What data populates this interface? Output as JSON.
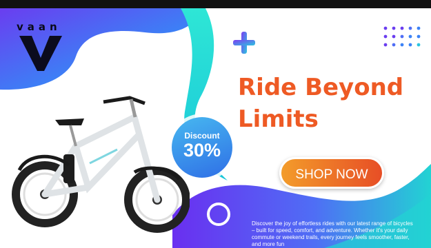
{
  "brand": {
    "name": "vaan"
  },
  "hero": {
    "headline_line1": "Ride Beyond",
    "headline_line2": "Limits"
  },
  "discount": {
    "label": "Discount",
    "value": "30%"
  },
  "cta": {
    "label": "SHOP NOW"
  },
  "description": "Discover the joy of effortless rides with our latest range of bicycles – built for speed, comfort, and adventure. Whether it's your daily commute or weekend trails, every journey feels smoother, faster, and more fun",
  "colors": {
    "accent_orange": "#ee5a24",
    "gradient_purple": "#6a3df0",
    "gradient_cyan": "#22d3d3",
    "gradient_blue": "#3b82f6"
  },
  "icons": [
    "plus-icon",
    "dot-grid-icon",
    "ring-icon",
    "bicycle-image"
  ]
}
